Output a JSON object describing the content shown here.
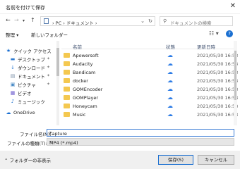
{
  "window": {
    "title": "名前を付けて保存"
  },
  "address": {
    "breadcrumb": "›  PC  ›  ドキュメント  ›"
  },
  "search": {
    "placeholder": "ドキュメントの検索"
  },
  "toolbar": {
    "organize_label": "整理 ▾",
    "new_folder_label": "新しいフォルダー"
  },
  "nav": {
    "items": [
      {
        "label": "クイック アクセス",
        "icon": "star-icon"
      },
      {
        "label": "デスクトップ",
        "icon": "desktop-icon"
      },
      {
        "label": "ダウンロード",
        "icon": "download-icon"
      },
      {
        "label": "ドキュメント",
        "icon": "documents-icon"
      },
      {
        "label": "ピクチャ",
        "icon": "pictures-icon"
      },
      {
        "label": "ビデオ",
        "icon": "videos-icon"
      },
      {
        "label": "ミュージック",
        "icon": "music-icon"
      },
      {
        "label": "OneDrive",
        "icon": "cloud-icon"
      }
    ]
  },
  "list": {
    "headers": {
      "name": "名前",
      "status": "状態",
      "date": "更新日時"
    },
    "rows": [
      {
        "name": "Apowersoft",
        "date": "2021/05/30 16:58"
      },
      {
        "name": "Audacity",
        "date": "2021/05/30 16:58"
      },
      {
        "name": "Bandicam",
        "date": "2021/05/30 16:58"
      },
      {
        "name": "docker",
        "date": "2021/05/30 16:58"
      },
      {
        "name": "GOMEncoder",
        "date": "2021/05/30 16:58"
      },
      {
        "name": "GOMPlayer",
        "date": "2021/05/30 16:58"
      },
      {
        "name": "Honeycam",
        "date": "2021/05/30 16:58"
      },
      {
        "name": "Music",
        "date": "2021/05/30 16:58"
      }
    ]
  },
  "form": {
    "filename_label": "ファイル名(N):",
    "filename_value": "capture",
    "filetype_label": "ファイルの種類(T):",
    "filetype_value": "MP4 (*.mp4)"
  },
  "footer": {
    "hide_folders_label": "フォルダーの非表示",
    "save_label": "保存(S)",
    "cancel_label": "キャンセル"
  }
}
